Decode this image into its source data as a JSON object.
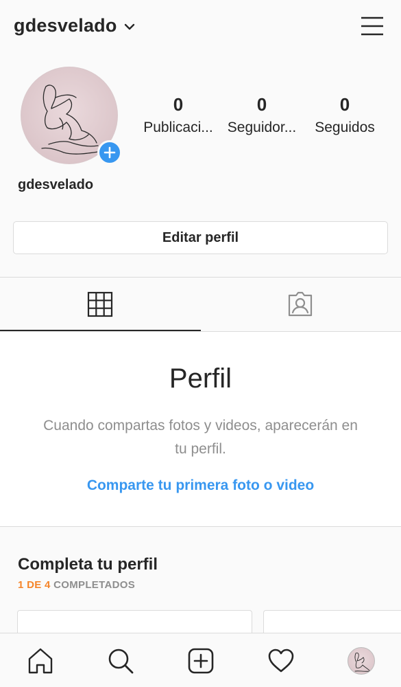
{
  "header": {
    "username": "gdesvelado",
    "icons": {
      "dropdown": "chevron-down-icon",
      "menu": "hamburger-menu-icon"
    }
  },
  "profile": {
    "display_name": "gdesvelado",
    "stats": [
      {
        "value": "0",
        "label": "Publicaci..."
      },
      {
        "value": "0",
        "label": "Seguidor..."
      },
      {
        "value": "0",
        "label": "Seguidos"
      }
    ],
    "edit_button": "Editar perfil"
  },
  "tabs": [
    {
      "icon": "grid-icon",
      "active": true
    },
    {
      "icon": "tagged-person-icon",
      "active": false
    }
  ],
  "empty_state": {
    "title": "Perfil",
    "description": "Cuando compartas fotos y videos, aparecerán en tu perfil.",
    "link": "Comparte tu primera foto o video"
  },
  "complete_profile": {
    "title": "Completa tu perfil",
    "progress_highlight": "1 DE 4",
    "progress_rest": "COMPLETADOS"
  },
  "bottom_nav": [
    "home-icon",
    "search-icon",
    "new-post-icon",
    "heart-icon",
    "profile-avatar"
  ],
  "colors": {
    "accent_blue": "#3897f0",
    "progress_orange": "#f58529",
    "text": "#262626",
    "secondary_text": "#8e8e8e",
    "border": "#dbdbdb",
    "background": "#fafafa"
  }
}
